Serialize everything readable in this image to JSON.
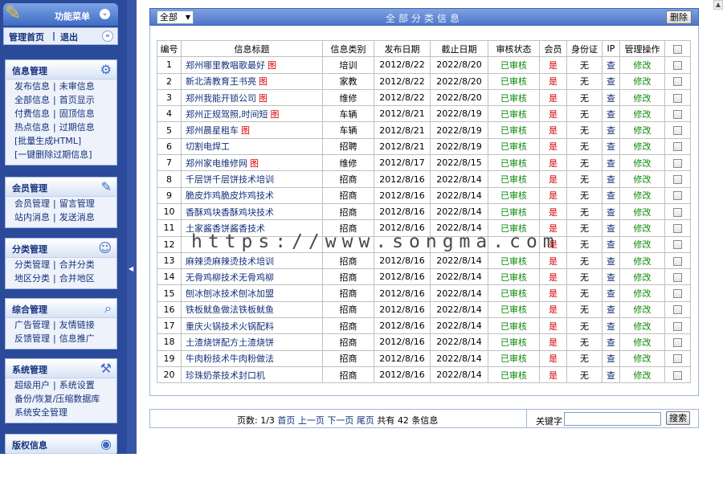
{
  "sidebar": {
    "brand_title": "功能菜单",
    "brand_ctl": "⌄",
    "topnav": {
      "home": "管理首页",
      "logout": "退出",
      "ctl": "«"
    },
    "groups": [
      {
        "title": "信息管理",
        "icon": "settings-icon",
        "rows": [
          [
            "发布信息",
            "未审信息"
          ],
          [
            "全部信息",
            "首页显示"
          ],
          [
            "付费信息",
            "固顶信息"
          ],
          [
            "热点信息",
            "过期信息"
          ],
          [
            "[批量生成HTML]"
          ],
          [
            "[一键删除过期信息]"
          ]
        ]
      },
      {
        "title": "会员管理",
        "icon": "edit-icon",
        "rows": [
          [
            "会员管理",
            "留言管理"
          ],
          [
            "站内消息",
            "发送消息"
          ]
        ]
      },
      {
        "title": "分类管理",
        "icon": "user-icon",
        "rows": [
          [
            "分类管理",
            "合并分类"
          ],
          [
            "地区分类",
            "合并地区"
          ]
        ]
      },
      {
        "title": "综合管理",
        "icon": "search-icon",
        "rows": [
          [
            "广告管理",
            "友情链接"
          ],
          [
            "反馈管理",
            "信息推广"
          ]
        ]
      },
      {
        "title": "系统管理",
        "icon": "tools-icon",
        "rows": [
          [
            "超级用户",
            "系统设置"
          ],
          [
            "备份/恢复/压缩数据库"
          ],
          [
            "系统安全管理"
          ]
        ]
      },
      {
        "title": "版权信息",
        "icon": "globe-icon",
        "rows": []
      }
    ]
  },
  "main": {
    "filter_value": "全部",
    "title": "全部分类信息",
    "delete_label": "删除",
    "columns": [
      "编号",
      "信息标题",
      "信息类别",
      "发布日期",
      "截止日期",
      "审核状态",
      "会员",
      "身份证",
      "IP",
      "管理操作",
      ""
    ],
    "rows": [
      {
        "id": "1",
        "title": "郑州哪里教唱歌最好",
        "pic": "图",
        "cat": "培训",
        "pub": "2012/8/22",
        "end": "2022/8/20",
        "status": "已审核",
        "member": "是",
        "idcard": "无",
        "ip": "查",
        "op": "修改"
      },
      {
        "id": "2",
        "title": "新北清教育王书亮",
        "pic": "图",
        "cat": "家教",
        "pub": "2012/8/22",
        "end": "2022/8/20",
        "status": "已审核",
        "member": "是",
        "idcard": "无",
        "ip": "查",
        "op": "修改"
      },
      {
        "id": "3",
        "title": "郑州我能开锁公司",
        "pic": "图",
        "cat": "维修",
        "pub": "2012/8/22",
        "end": "2022/8/20",
        "status": "已审核",
        "member": "是",
        "idcard": "无",
        "ip": "查",
        "op": "修改"
      },
      {
        "id": "4",
        "title": "郑州正规驾照,时间短",
        "pic": "图",
        "cat": "车辆",
        "pub": "2012/8/21",
        "end": "2022/8/19",
        "status": "已审核",
        "member": "是",
        "idcard": "无",
        "ip": "查",
        "op": "修改"
      },
      {
        "id": "5",
        "title": "郑州晨星租车",
        "pic": "图",
        "cat": "车辆",
        "pub": "2012/8/21",
        "end": "2022/8/19",
        "status": "已审核",
        "member": "是",
        "idcard": "无",
        "ip": "查",
        "op": "修改"
      },
      {
        "id": "6",
        "title": "切割电焊工",
        "pic": "",
        "cat": "招聘",
        "pub": "2012/8/21",
        "end": "2022/8/19",
        "status": "已审核",
        "member": "是",
        "idcard": "无",
        "ip": "查",
        "op": "修改"
      },
      {
        "id": "7",
        "title": "郑州家电维修网",
        "pic": "图",
        "cat": "维修",
        "pub": "2012/8/17",
        "end": "2022/8/15",
        "status": "已审核",
        "member": "是",
        "idcard": "无",
        "ip": "查",
        "op": "修改"
      },
      {
        "id": "8",
        "title": "千层饼千层饼技术培训",
        "pic": "",
        "cat": "招商",
        "pub": "2012/8/16",
        "end": "2022/8/14",
        "status": "已审核",
        "member": "是",
        "idcard": "无",
        "ip": "查",
        "op": "修改"
      },
      {
        "id": "9",
        "title": "脆皮炸鸡脆皮炸鸡技术",
        "pic": "",
        "cat": "招商",
        "pub": "2012/8/16",
        "end": "2022/8/14",
        "status": "已审核",
        "member": "是",
        "idcard": "无",
        "ip": "查",
        "op": "修改"
      },
      {
        "id": "10",
        "title": "香酥鸡块香酥鸡块技术",
        "pic": "",
        "cat": "招商",
        "pub": "2012/8/16",
        "end": "2022/8/14",
        "status": "已审核",
        "member": "是",
        "idcard": "无",
        "ip": "查",
        "op": "修改"
      },
      {
        "id": "11",
        "title": "土家酱香饼酱香技术",
        "pic": "",
        "cat": "招商",
        "pub": "2012/8/16",
        "end": "2022/8/14",
        "status": "已审核",
        "member": "是",
        "idcard": "无",
        "ip": "查",
        "op": "修改"
      },
      {
        "id": "12",
        "title": "",
        "pic": "",
        "cat": "",
        "pub": "",
        "end": "",
        "status": "",
        "member": "是",
        "idcard": "无",
        "ip": "查",
        "op": "修改"
      },
      {
        "id": "13",
        "title": "麻辣烫麻辣烫技术培训",
        "pic": "",
        "cat": "招商",
        "pub": "2012/8/16",
        "end": "2022/8/14",
        "status": "已审核",
        "member": "是",
        "idcard": "无",
        "ip": "查",
        "op": "修改"
      },
      {
        "id": "14",
        "title": "无骨鸡柳技术无骨鸡柳",
        "pic": "",
        "cat": "招商",
        "pub": "2012/8/16",
        "end": "2022/8/14",
        "status": "已审核",
        "member": "是",
        "idcard": "无",
        "ip": "查",
        "op": "修改"
      },
      {
        "id": "15",
        "title": "刨冰刨冰技术刨冰加盟",
        "pic": "",
        "cat": "招商",
        "pub": "2012/8/16",
        "end": "2022/8/14",
        "status": "已审核",
        "member": "是",
        "idcard": "无",
        "ip": "查",
        "op": "修改"
      },
      {
        "id": "16",
        "title": "铁板鱿鱼做法铁板鱿鱼",
        "pic": "",
        "cat": "招商",
        "pub": "2012/8/16",
        "end": "2022/8/14",
        "status": "已审核",
        "member": "是",
        "idcard": "无",
        "ip": "查",
        "op": "修改"
      },
      {
        "id": "17",
        "title": "重庆火锅技术火锅配料",
        "pic": "",
        "cat": "招商",
        "pub": "2012/8/16",
        "end": "2022/8/14",
        "status": "已审核",
        "member": "是",
        "idcard": "无",
        "ip": "查",
        "op": "修改"
      },
      {
        "id": "18",
        "title": "土渣烧饼配方土渣烧饼",
        "pic": "",
        "cat": "招商",
        "pub": "2012/8/16",
        "end": "2022/8/14",
        "status": "已审核",
        "member": "是",
        "idcard": "无",
        "ip": "查",
        "op": "修改"
      },
      {
        "id": "19",
        "title": "牛肉粉技术牛肉粉做法",
        "pic": "",
        "cat": "招商",
        "pub": "2012/8/16",
        "end": "2022/8/14",
        "status": "已审核",
        "member": "是",
        "idcard": "无",
        "ip": "查",
        "op": "修改"
      },
      {
        "id": "20",
        "title": "珍珠奶茶技术封口机",
        "pic": "",
        "cat": "招商",
        "pub": "2012/8/16",
        "end": "2022/8/14",
        "status": "已审核",
        "member": "是",
        "idcard": "无",
        "ip": "查",
        "op": "修改"
      }
    ],
    "pager": {
      "page_label": "页数: 1/3",
      "first": "首页",
      "prev": "上一页",
      "next": "下一页",
      "last": "尾页",
      "total": "共有 42 条信息",
      "keyword_label": "关键字",
      "keyword_value": "",
      "search_label": "搜索"
    }
  },
  "watermark": "https://www.songma.com",
  "colors": {
    "sidebar_bg": "#2b4a9a",
    "header_bg": "#4f77c8",
    "status_green": "#0a8a0a",
    "member_red": "#d00000"
  }
}
